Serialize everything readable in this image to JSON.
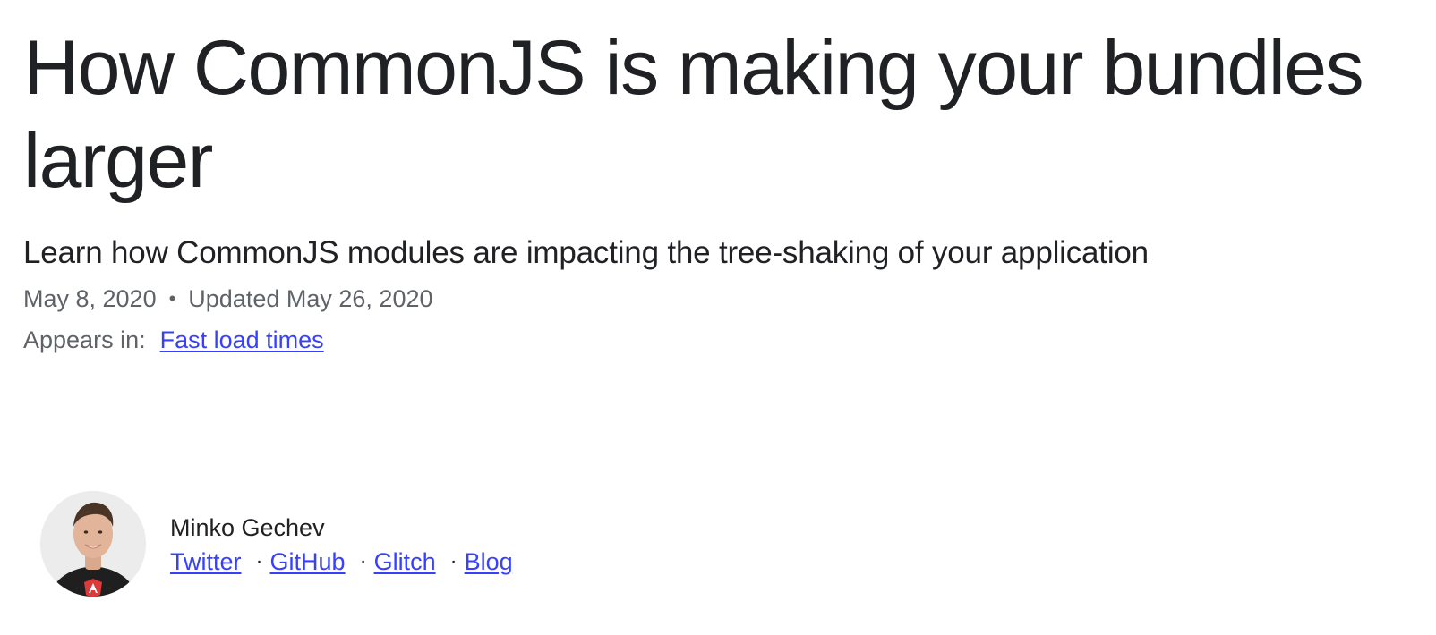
{
  "article": {
    "title": "How CommonJS is making your bundles larger",
    "subtitle": "Learn how CommonJS modules are impacting the tree-shaking of your application",
    "published": "May 8, 2020",
    "separator": "•",
    "updated": "Updated May 26, 2020",
    "appears_label": "Appears in:",
    "appears_link": "Fast load times"
  },
  "author": {
    "name": "Minko Gechev",
    "avatar_icon": "author-photo",
    "link_separator": "·",
    "links": [
      "Twitter",
      "GitHub",
      "Glitch",
      "Blog"
    ]
  },
  "colors": {
    "text": "#202124",
    "muted": "#5f6368",
    "link": "#3740ff",
    "background": "#ffffff"
  }
}
